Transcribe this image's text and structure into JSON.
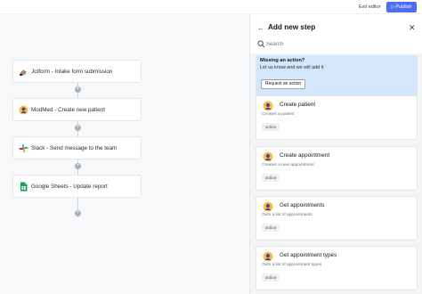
{
  "topbar": {
    "exit_label": "Exit editor",
    "publish_label": "Publish"
  },
  "workflow": {
    "steps": [
      {
        "label": "Jotform - Intake form submission",
        "icon": "jotform-icon"
      },
      {
        "label": "ModMed - Create new patient",
        "icon": "modmed-icon"
      },
      {
        "label": "Slack - Send message to the team",
        "icon": "slack-icon"
      },
      {
        "label": "Google Sheets - Update report",
        "icon": "google-sheets-icon"
      }
    ],
    "add_symbol": "+"
  },
  "panel": {
    "title": "Add new step",
    "search": {
      "placeholder": "Search",
      "value": ""
    },
    "missing": {
      "title": "Missing an action?",
      "subtitle": "Let us know and we will add it",
      "button_label": "Request an action"
    },
    "actions": [
      {
        "title": "Create patient",
        "description": "Creates a patient",
        "badge": "action"
      },
      {
        "title": "Create appointment",
        "description": "Creates a new appointment",
        "badge": "action"
      },
      {
        "title": "Get appointments",
        "description": "Gets a list of appointments",
        "badge": "action"
      },
      {
        "title": "Get appointment types",
        "description": "Gets a list of appointment types",
        "badge": "action"
      }
    ]
  },
  "colors": {
    "accent": "#4f6ef7",
    "banner": "#d3e6fa"
  }
}
